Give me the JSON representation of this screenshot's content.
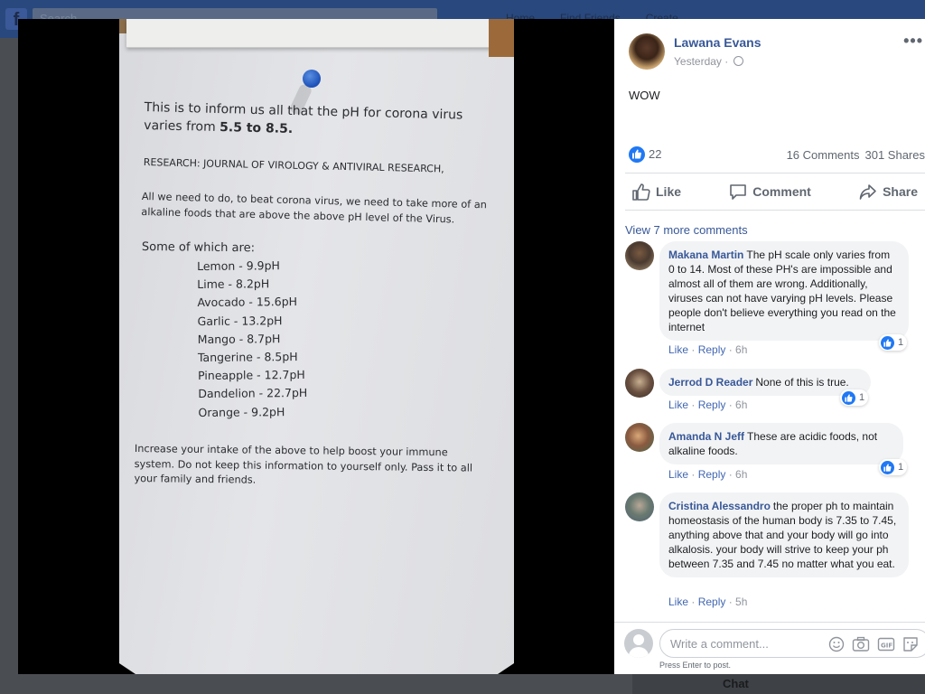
{
  "background": {
    "search_placeholder": "Search",
    "nav_items": [
      "Home",
      "Find Friends",
      "Create"
    ],
    "chat_label": "Chat"
  },
  "photo": {
    "line1": "This is to inform us all that the pH for corona virus",
    "line2_prefix": "varies from ",
    "line2_bold": "5.5 to 8.5.",
    "research": "RESEARCH: JOURNAL OF VIROLOGY & ANTIVIRAL RESEARCH,",
    "para1_line1": "All we need to do, to beat corona virus, we need to take more of an",
    "para1_line2": "alkaline foods that are above the above pH level of the Virus.",
    "some_of_which": "Some of which are:",
    "foods": [
      "Lemon - 9.9pH",
      "Lime - 8.2pH",
      "Avocado - 15.6pH",
      "Garlic - 13.2pH",
      "Mango - 8.7pH",
      "Tangerine - 8.5pH",
      "Pineapple - 12.7pH",
      "Dandelion - 22.7pH",
      "Orange - 9.2pH"
    ],
    "para2_line1": "Increase your intake of the above to help boost your immune",
    "para2_line2": "system. Do not keep this information to yourself only. Pass it to all",
    "para2_line3": "your family and friends."
  },
  "post": {
    "author": "Lawana Evans",
    "time": "Yesterday ·",
    "text": "WOW",
    "like_count": "22",
    "comments_count": "16 Comments",
    "shares_count": "301 Shares",
    "actions": {
      "like": "Like",
      "comment": "Comment",
      "share": "Share"
    },
    "view_more": "View 7 more comments"
  },
  "comments": [
    {
      "name": "Makana Martin",
      "text": "The pH scale only varies from 0 to 14. Most of these PH's are impossible and almost all of them are wrong. Additionally, viruses can not have varying pH levels. Please people don't believe everything you read on the internet",
      "like": "Like",
      "reply": "Reply",
      "time": "6h",
      "reactions": "1"
    },
    {
      "name": "Jerrod D Reader",
      "text": "None of this is true.",
      "like": "Like",
      "reply": "Reply",
      "time": "6h",
      "reactions": "1"
    },
    {
      "name": "Amanda N Jeff",
      "text": "These are acidic foods, not alkaline foods.",
      "like": "Like",
      "reply": "Reply",
      "time": "6h",
      "reactions": "1"
    },
    {
      "name": "Cristina Alessandro",
      "text": "the proper ph to maintain homeostasis of the human body is 7.35 to 7.45, anything above that and your body will go into alkalosis. your body will strive to keep your ph between 7.35 and 7.45 no matter what you eat.",
      "like": "Like",
      "reply": "Reply",
      "time": "5h"
    }
  ],
  "write_comment": {
    "placeholder": "Write a comment...",
    "hint": "Press Enter to post."
  },
  "colors": {
    "link_blue": "#385898",
    "like_blue": "#2078f4",
    "lightbox_bg": "#000000"
  },
  "icons": [
    "search-icon",
    "globe-icon",
    "more-icon",
    "thumbs-up-icon",
    "comment-icon",
    "share-icon",
    "emoji-icon",
    "camera-icon",
    "gif-icon",
    "sticker-icon"
  ]
}
